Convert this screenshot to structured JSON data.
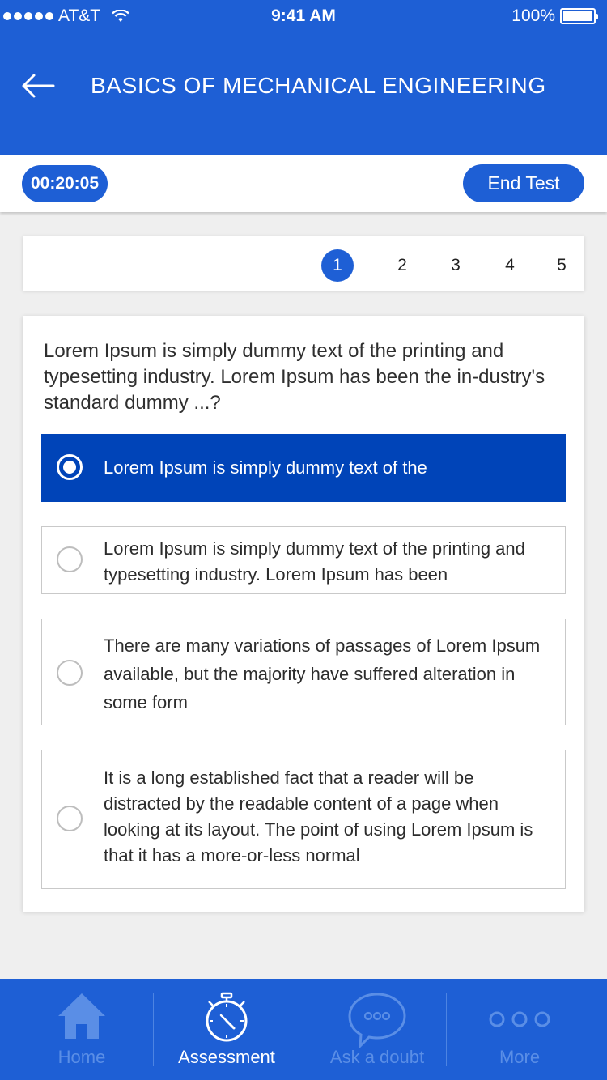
{
  "status_bar": {
    "carrier": "AT&T",
    "time": "9:41 AM",
    "battery": "100%"
  },
  "header": {
    "title": "BASICS OF MECHANICAL ENGINEERING"
  },
  "test_bar": {
    "timer": "00:20:05",
    "end_test_label": "End Test"
  },
  "pagination": {
    "pages": [
      "1",
      "2",
      "3",
      "4",
      "5"
    ],
    "current": "1"
  },
  "question": {
    "text": "Lorem Ipsum is simply dummy text of the printing and typesetting industry. Lorem Ipsum has been the in-dustry's standard dummy ...?",
    "options": [
      {
        "text": "Lorem Ipsum is simply dummy text of the",
        "selected": true
      },
      {
        "text": "Lorem Ipsum is simply dummy text of the printing and typesetting industry. Lorem Ipsum has been",
        "selected": false
      },
      {
        "text": "There are many variations of passages of Lorem Ipsum available, but the majority have suffered alteration in some form",
        "selected": false
      },
      {
        "text": "It is a long established fact that a reader will be distracted by the readable content of a page when looking at its layout. The point of using Lorem Ipsum is that it has a more-or-less normal",
        "selected": false
      }
    ]
  },
  "bottom_nav": {
    "items": [
      {
        "label": "Home",
        "icon": "home-icon",
        "active": false
      },
      {
        "label": "Assessment",
        "icon": "stopwatch-icon",
        "active": true
      },
      {
        "label": "Ask a doubt",
        "icon": "chat-bubble-icon",
        "active": false
      },
      {
        "label": "More",
        "icon": "more-dots-icon",
        "active": false
      }
    ]
  },
  "colors": {
    "primary": "#1e5fd5",
    "selected_option": "#0044b8",
    "background": "#efefef"
  }
}
